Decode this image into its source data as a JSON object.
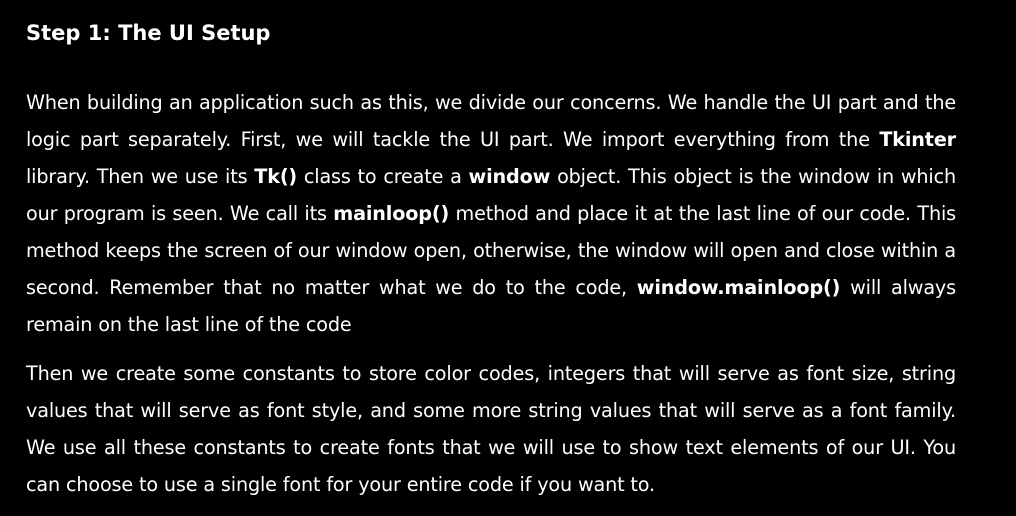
{
  "heading": "Step 1: The UI Setup",
  "paragraph1": {
    "t1": "When building an application such as this, we divide our concerns. We handle the UI part and the logic part separately. First, we will tackle the UI part. We import everything from the ",
    "b1": "Tkinter",
    "t2": " library. Then we use its ",
    "b2": "Tk()",
    "t3": " class to create a ",
    "b3": "window",
    "t4": " object. This object is the window in which our program is seen. We call its ",
    "b4": "mainloop()",
    "t5": " method and place it at the last line of our code. This method keeps the screen of our window open, otherwise, the window will open and close within a second. Remember that no matter what we do to the code, ",
    "b5": "window.mainloop()",
    "t6": " will always remain on the last line of the code"
  },
  "paragraph2": "Then we create some constants to store color codes, integers that will serve as font size, string values that will serve as font style, and some more string values that will serve as a font family. We use all these constants to create fonts that we will use to show text elements of our UI. You can choose to use a single font for your entire code if you want to."
}
